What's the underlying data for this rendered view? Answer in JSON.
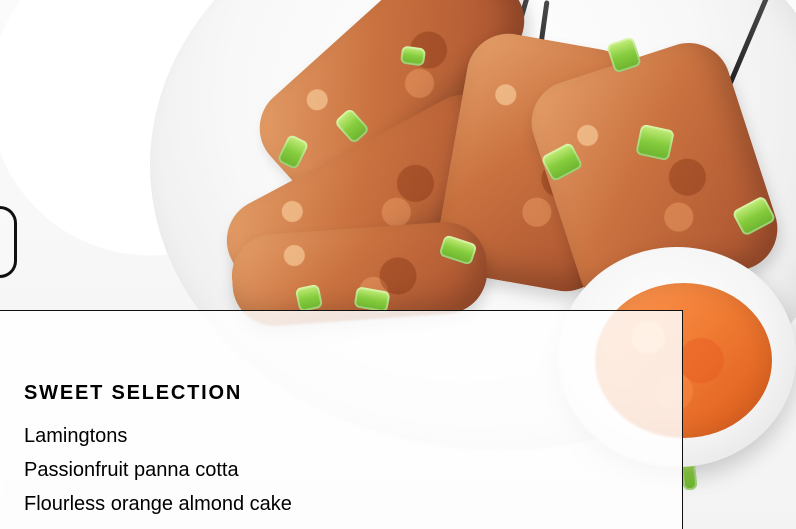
{
  "menu": {
    "section_title": "SWEET SELECTION",
    "items": [
      "Lamingtons",
      "Passionfruit panna cotta",
      "Flourless orange almond cake"
    ]
  },
  "colors": {
    "text": "#000000",
    "card_background": "#ffffff",
    "card_border": "#111111"
  }
}
